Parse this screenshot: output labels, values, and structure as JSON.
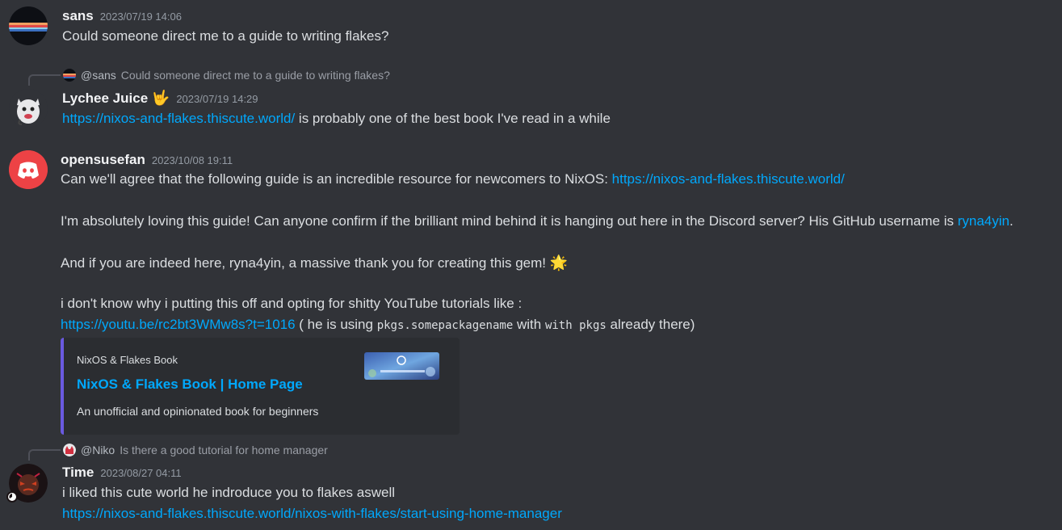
{
  "messages": {
    "m1": {
      "author": "sans",
      "timestamp": "2023/07/19 14:06",
      "text": "Could someone direct me to a guide to writing flakes?"
    },
    "m2": {
      "reply_author": "@sans",
      "reply_text": "Could someone direct me to a guide to writing flakes?",
      "author": "Lychee Juice",
      "author_emoji": "🤟",
      "timestamp": "2023/07/19 14:29",
      "link": "https://nixos-and-flakes.thiscute.world/",
      "text_after_link": " is probably one of the best book I've read in a while"
    },
    "m3": {
      "author": "opensusefan",
      "timestamp": "2023/10/08 19:11",
      "p1_text": "Can we'll agree that the following guide is an incredible resource for newcomers to NixOS: ",
      "p1_link": "https://nixos-and-flakes.thiscute.world/",
      "p2_text": "I'm absolutely loving this guide! Can anyone confirm if the brilliant mind behind it is hanging out here in the Discord server? His GitHub username is ",
      "p2_link": "ryna4yin",
      "p2_end": ".",
      "p3_text": "And if you are indeed here, ryna4yin, a massive thank you for creating this gem! ",
      "p3_emoji": "🌟",
      "p4_text": "i don't know why i putting this off and opting for shitty YouTube tutorials like :",
      "p5_link": "https://youtu.be/rc2bt3WMw8s?t=1016",
      "p5_text1": " ( he is using ",
      "p5_code1": "pkgs.somepackagename",
      "p5_text2": " with ",
      "p5_code2": "with pkgs",
      "p5_text3": " already there)",
      "embed": {
        "provider": "NixOS & Flakes Book",
        "title": "NixOS & Flakes Book | Home Page",
        "description": "An unofficial and opinionated book for beginners"
      }
    },
    "m4": {
      "reply_author": "@Niko",
      "reply_text": "Is there a good tutorial for home manager",
      "author": "Time",
      "timestamp": "2023/08/27 04:11",
      "text": "i liked this cute world he indroduce you to flakes aswell",
      "link": "https://nixos-and-flakes.thiscute.world/nixos-with-flakes/start-using-home-manager"
    }
  },
  "colors": {
    "background": "#313338",
    "link": "#00a8fc",
    "embed_border": "#6a5ae0",
    "discord_red": "#ed4245"
  }
}
